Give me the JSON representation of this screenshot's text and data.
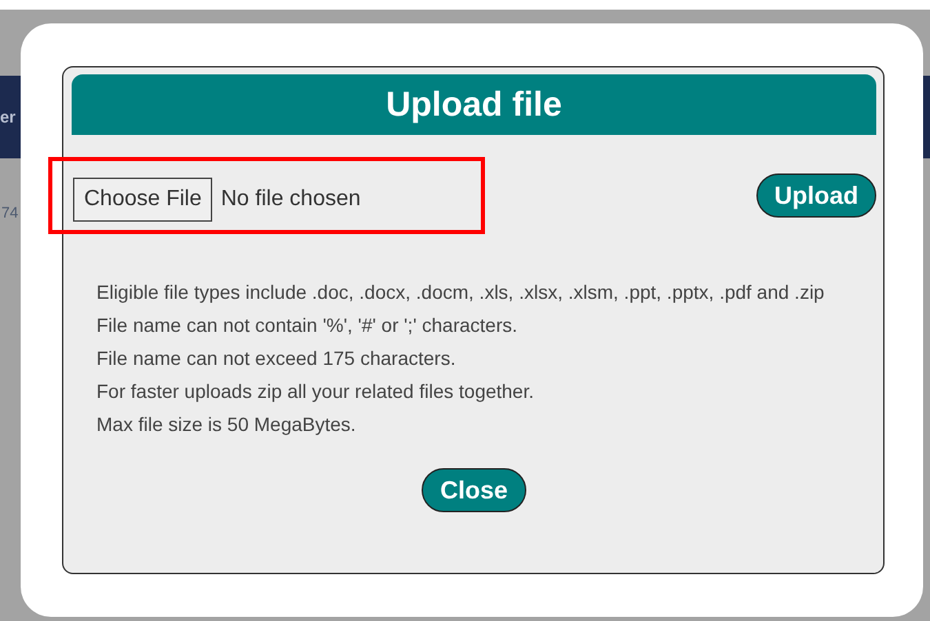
{
  "background_page": {
    "header_text": "er",
    "row_text": "74"
  },
  "dialog": {
    "title": "Upload file",
    "file_input": {
      "button": "Choose File",
      "status": "No file chosen",
      "highlighted": true
    },
    "upload_button": "Upload",
    "notes": [
      "Eligible file types include .doc, .docx, .docm, .xls, .xlsx, .xlsm, .ppt, .pptx, .pdf and .zip",
      "File name can not contain '%', '#' or ';' characters.",
      "File name can not exceed 175 characters.",
      "For faster uploads zip all your related files together.",
      "Max file size is 50 MegaBytes."
    ],
    "close_button": "Close"
  }
}
